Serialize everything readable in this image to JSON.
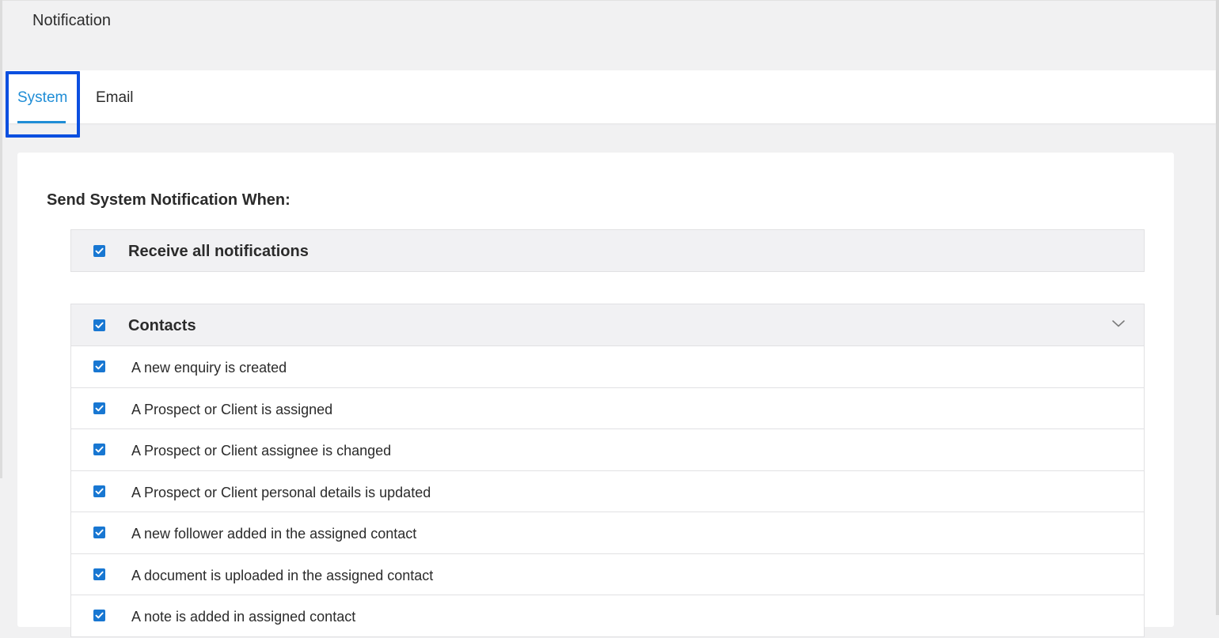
{
  "page": {
    "title": "Notification"
  },
  "tabs": [
    {
      "label": "System",
      "active": true
    },
    {
      "label": "Email",
      "active": false
    }
  ],
  "colors": {
    "accent": "#1f8dd6",
    "checkbox": "#1877d2",
    "focus": "#0b4fe0"
  },
  "section": {
    "title": "Send System Notification When:"
  },
  "receive_all": {
    "label": "Receive all notifications",
    "checked": true
  },
  "contacts": {
    "label": "Contacts",
    "checked": true,
    "expand_icon": "chevron-down-icon",
    "items": [
      {
        "label": "A new enquiry is created",
        "checked": true
      },
      {
        "label": "A Prospect or Client is assigned",
        "checked": true
      },
      {
        "label": "A Prospect or Client assignee is changed",
        "checked": true
      },
      {
        "label": "A Prospect or Client personal details is updated",
        "checked": true
      },
      {
        "label": "A new follower added in the assigned contact",
        "checked": true
      },
      {
        "label": "A document is uploaded in the assigned contact",
        "checked": true
      },
      {
        "label": "A note is added in assigned contact",
        "checked": true
      }
    ]
  }
}
